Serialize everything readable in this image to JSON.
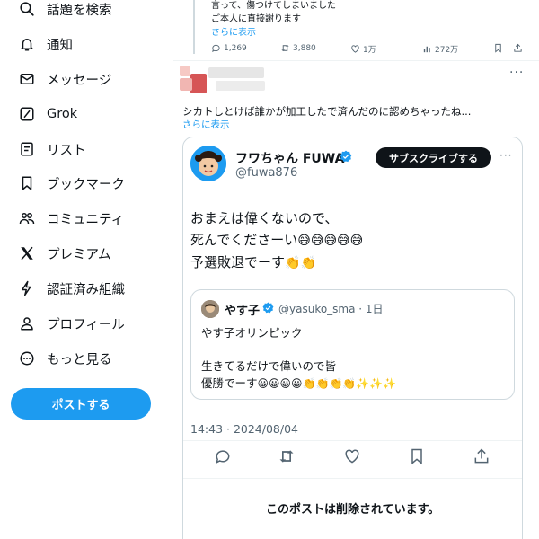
{
  "sidebar": {
    "items": [
      {
        "label": "話題を検索",
        "icon": "search-icon"
      },
      {
        "label": "通知",
        "icon": "bell-icon"
      },
      {
        "label": "メッセージ",
        "icon": "envelope-icon"
      },
      {
        "label": "Grok",
        "icon": "grok-icon"
      },
      {
        "label": "リスト",
        "icon": "list-icon"
      },
      {
        "label": "ブックマーク",
        "icon": "bookmark-icon"
      },
      {
        "label": "コミュニティ",
        "icon": "community-icon"
      },
      {
        "label": "プレミアム",
        "icon": "x-logo-icon"
      },
      {
        "label": "認証済み組織",
        "icon": "lightning-icon"
      },
      {
        "label": "プロフィール",
        "icon": "person-icon"
      },
      {
        "label": "もっと見る",
        "icon": "more-circle-icon"
      }
    ],
    "post_button": "ポストする"
  },
  "previous_post": {
    "line1": "言って、傷つけてしまいました",
    "line2": "ご本人に直接謝ります",
    "more": "さらに表示",
    "replies": "1,269",
    "reposts": "3,880",
    "likes": "1万",
    "views": "272万"
  },
  "reply": {
    "text": "シカトしとけば誰かが加工したで済んだのに認めちゃったね...",
    "more": "さらに表示"
  },
  "quoted_post": {
    "display_name": "フワちゃん FUWA",
    "handle": "@fuwa876",
    "subscribe": "サブスクライブする",
    "line1": "おまえは偉くないので、",
    "line2": "死んでくださーい",
    "line2_emoji": "😅😅😅😅😅",
    "line3": "予選敗退でーす",
    "line3_emoji": "👏👏",
    "timestamp": "14:43 · 2024/08/04",
    "deleted_notice": "このポストは削除されています。"
  },
  "inner_quote": {
    "display_name": "やす子",
    "handle": "@yasuko_sma · 1日",
    "line1": "やす子オリンピック",
    "line2": "生きてるだけで偉いので皆",
    "line3": "優勝でーす",
    "line3_emoji": "😀😀😀😀👏👏👏👏✨✨✨"
  },
  "colors": {
    "accent": "#1d9bf0",
    "text": "#0f1419",
    "muted": "#536471",
    "border": "#cfd9de"
  }
}
